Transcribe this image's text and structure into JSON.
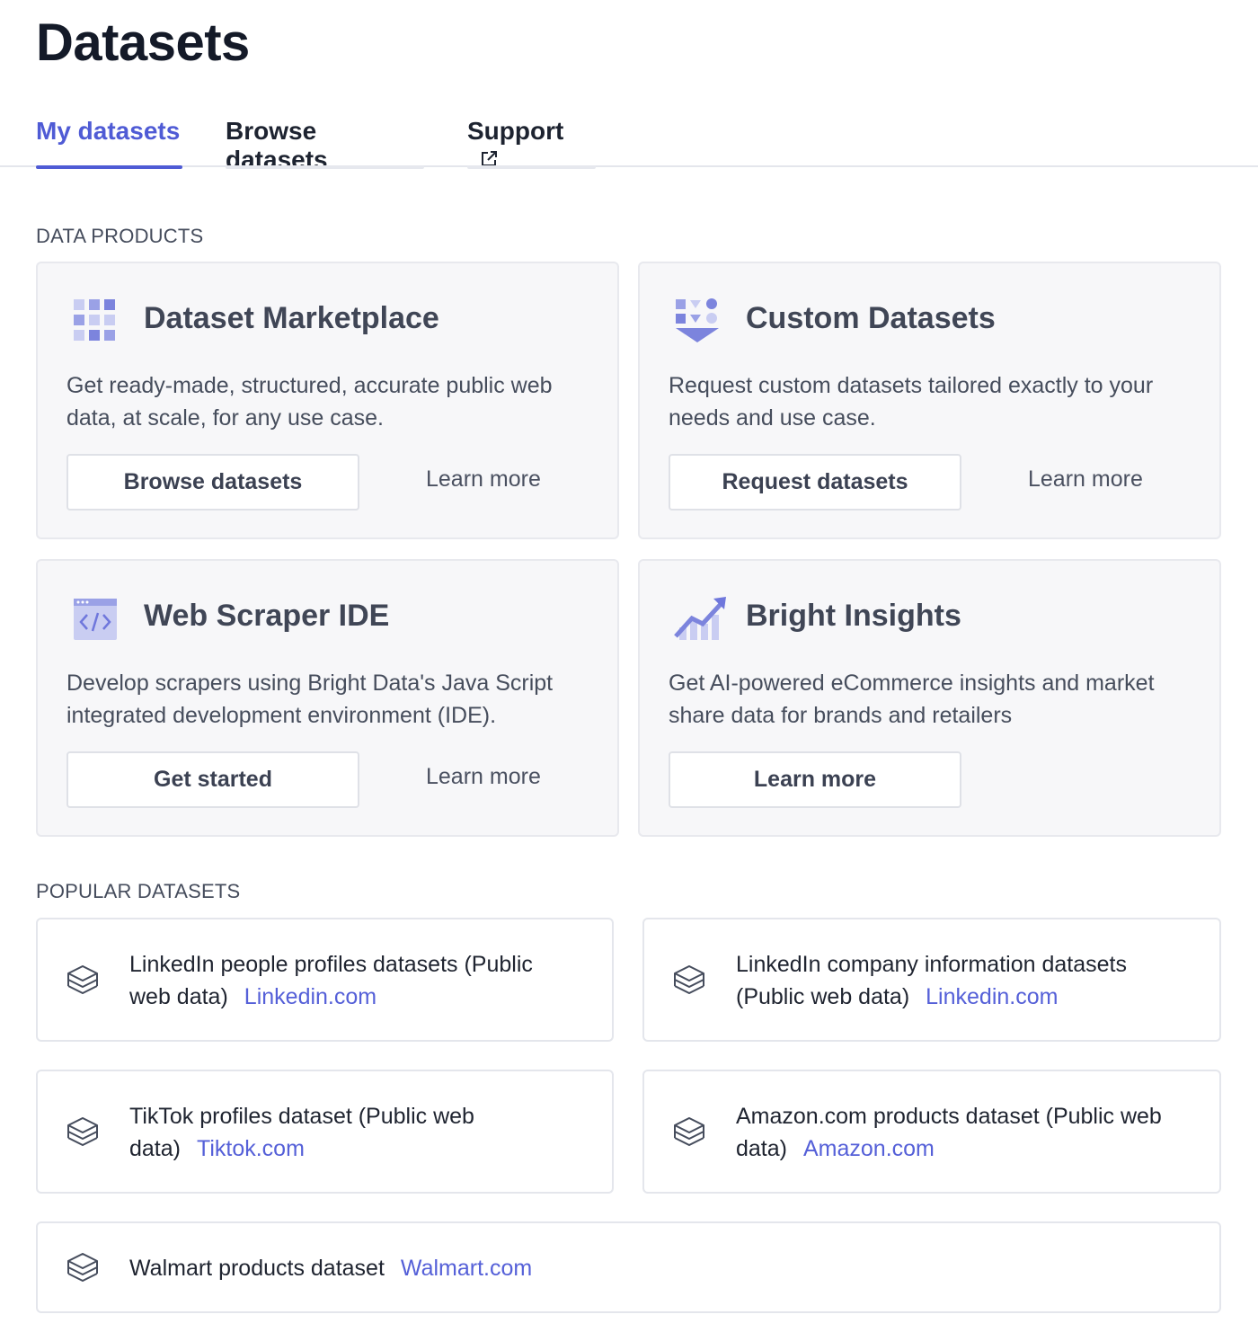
{
  "page": {
    "title": "Datasets"
  },
  "tabs": [
    {
      "label": "My datasets",
      "active": true
    },
    {
      "label": "Browse datasets",
      "active": false
    },
    {
      "label": "Support",
      "active": false,
      "icon": "external-link-icon"
    }
  ],
  "sections": {
    "data_products": "DATA PRODUCTS",
    "popular_datasets": "POPULAR DATASETS"
  },
  "products": [
    {
      "icon": "grid-icon",
      "title": "Dataset Marketplace",
      "description": "Get ready-made, structured, accurate public web data, at scale, for any use case.",
      "button": "Browse datasets",
      "link": "Learn more"
    },
    {
      "icon": "custom-shapes-icon",
      "title": "Custom Datasets",
      "description": "Request custom datasets tailored exactly to your needs and use case.",
      "button": "Request datasets",
      "link": "Learn more"
    },
    {
      "icon": "code-window-icon",
      "title": "Web Scraper IDE",
      "description": "Develop scrapers using Bright Data's Java Script integrated development environment (IDE).",
      "button": "Get started",
      "link": "Learn more"
    },
    {
      "icon": "trend-chart-icon",
      "title": "Bright Insights",
      "description": "Get AI-powered eCommerce insights and market share data for brands and retailers",
      "button": "Learn more"
    }
  ],
  "popular": [
    {
      "icon": "layers-icon",
      "line1": "LinkedIn people profiles datasets (Public",
      "line2": "web data)",
      "link": "Linkedin.com"
    },
    {
      "icon": "layers-icon",
      "line1": "LinkedIn company information datasets",
      "line2": "(Public web data)",
      "link": "Linkedin.com"
    },
    {
      "icon": "layers-icon",
      "line1": "TikTok profiles dataset (Public web",
      "line2": "data)",
      "link": "Tiktok.com"
    },
    {
      "icon": "layers-icon",
      "line1": "Amazon.com products dataset (Public web",
      "line2": "data)",
      "link": "Amazon.com"
    },
    {
      "icon": "layers-icon",
      "line1": "Walmart products dataset",
      "link": "Walmart.com"
    }
  ],
  "colors": {
    "accent": "#4f5bd5",
    "link": "#5560d8",
    "icon_light": "#c9cdf2",
    "icon_mid": "#9aa1e6",
    "icon_dark": "#6f77dc"
  }
}
